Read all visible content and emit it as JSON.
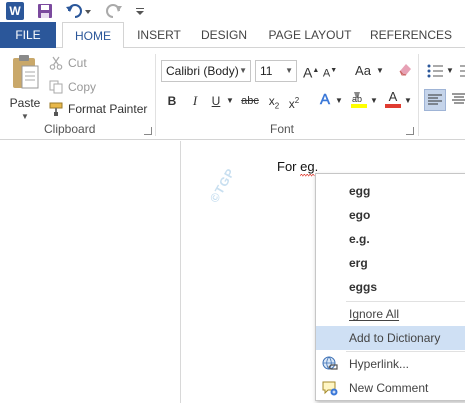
{
  "quick_access": {
    "word_logo": "W",
    "icons": [
      "word-icon",
      "save-icon",
      "undo-icon",
      "redo-icon",
      "customize-icon"
    ]
  },
  "tabs": {
    "file": "FILE",
    "home": "HOME",
    "insert": "INSERT",
    "design": "DESIGN",
    "page_layout": "PAGE LAYOUT",
    "references": "REFERENCES"
  },
  "clipboard": {
    "paste": "Paste",
    "cut": "Cut",
    "copy": "Copy",
    "format_painter": "Format Painter",
    "group_label": "Clipboard"
  },
  "font": {
    "font_name": "Calibri (Body)",
    "font_size": "11",
    "group_label": "Font",
    "grow_font": "A",
    "shrink_font": "A",
    "change_case": "Aa",
    "bold": "B",
    "italic": "I",
    "underline": "U",
    "strikethrough": "abc",
    "subscript": "x",
    "subscript_sub": "2",
    "superscript": "x",
    "superscript_sup": "2",
    "text_effects": "A",
    "font_color_letter": "A"
  },
  "document": {
    "text_before": "For ",
    "misspelled_word": "eg",
    "text_after": ".",
    "watermark": "©TGP"
  },
  "context_menu": {
    "suggestions": [
      "egg",
      "ego",
      "e.g.",
      "erg",
      "eggs"
    ],
    "ignore_all": "Ignore All",
    "add_to_dictionary": "Add to Dictionary",
    "hyperlink": "Hyperlink...",
    "new_comment": "New Comment"
  },
  "colors": {
    "accent": "#2b579a",
    "highlight_menu": "#cfe0f4",
    "highlight_yellow": "#ffff00",
    "font_color_red": "#e03c31",
    "spell_squiggle": "#e03c31"
  }
}
